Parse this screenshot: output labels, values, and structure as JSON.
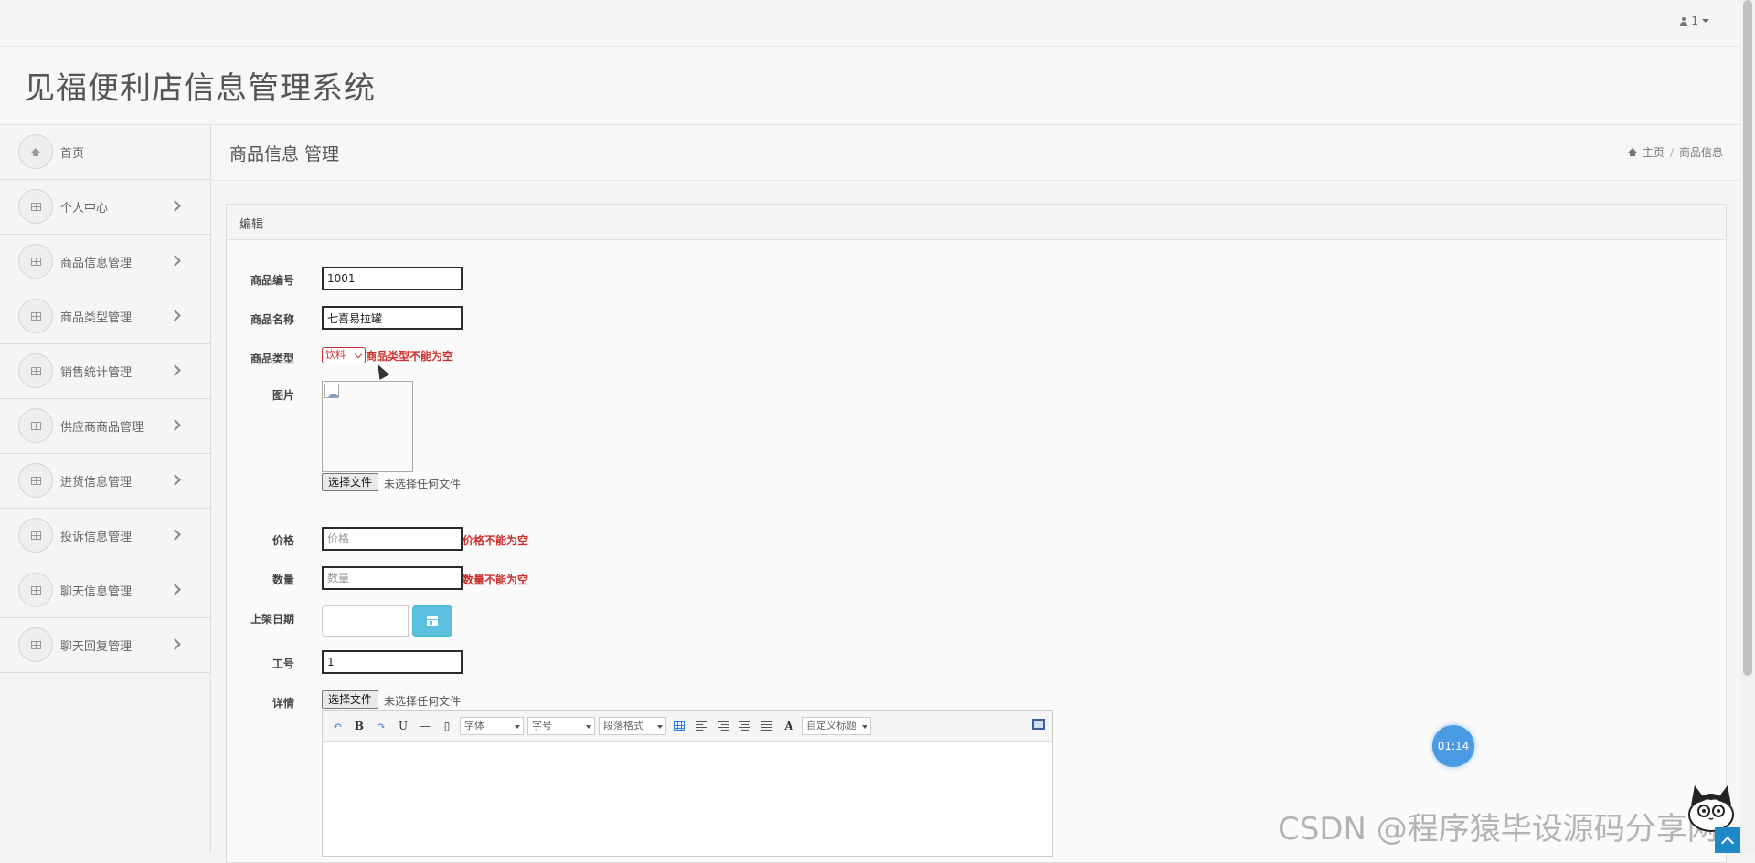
{
  "topbar": {
    "user_label": "1"
  },
  "brand": {
    "title": "见福便利店信息管理系统"
  },
  "sidebar": {
    "items": [
      {
        "label": "首页",
        "icon": "home-icon",
        "chevron": false
      },
      {
        "label": "个人中心",
        "icon": "grid-icon",
        "chevron": true
      },
      {
        "label": "商品信息管理",
        "icon": "grid-icon",
        "chevron": true
      },
      {
        "label": "商品类型管理",
        "icon": "grid-icon",
        "chevron": true
      },
      {
        "label": "销售统计管理",
        "icon": "grid-icon",
        "chevron": true
      },
      {
        "label": "供应商商品管理",
        "icon": "grid-icon",
        "chevron": true
      },
      {
        "label": "进货信息管理",
        "icon": "grid-icon",
        "chevron": true
      },
      {
        "label": "投诉信息管理",
        "icon": "grid-icon",
        "chevron": true
      },
      {
        "label": "聊天信息管理",
        "icon": "grid-icon",
        "chevron": true
      },
      {
        "label": "聊天回复管理",
        "icon": "grid-icon",
        "chevron": true
      }
    ]
  },
  "header": {
    "title": "商品信息 管理",
    "breadcrumb": {
      "home": "主页",
      "current": "商品信息"
    }
  },
  "panel": {
    "heading": "编辑"
  },
  "form": {
    "code": {
      "label": "商品编号",
      "value": "1001"
    },
    "name": {
      "label": "商品名称",
      "value": "七喜易拉罐"
    },
    "type": {
      "label": "商品类型",
      "selected": "饮料",
      "error": "商品类型不能为空"
    },
    "image": {
      "label": "图片",
      "file_button": "选择文件",
      "file_note": "未选择任何文件"
    },
    "price": {
      "label": "价格",
      "placeholder": "价格",
      "error": "价格不能为空"
    },
    "quantity": {
      "label": "数量",
      "placeholder": "数量",
      "error": "数量不能为空"
    },
    "date": {
      "label": "上架日期"
    },
    "staff_no": {
      "label": "工号",
      "value": "1"
    },
    "detail": {
      "label": "详情",
      "file_button": "选择文件",
      "file_note": "未选择任何文件"
    }
  },
  "editor": {
    "font_label": "字体",
    "size_label": "字号",
    "para_label": "段落格式",
    "custom_label": "自定义标题",
    "bold": "B",
    "underline": "U",
    "font_color": "A"
  },
  "timer": "01:14",
  "watermark": "CSDN @程序猿毕设源码分享网",
  "colors": {
    "error": "#c9302c",
    "calendar_button": "#5bc0de",
    "timer": "#4a9be3"
  }
}
